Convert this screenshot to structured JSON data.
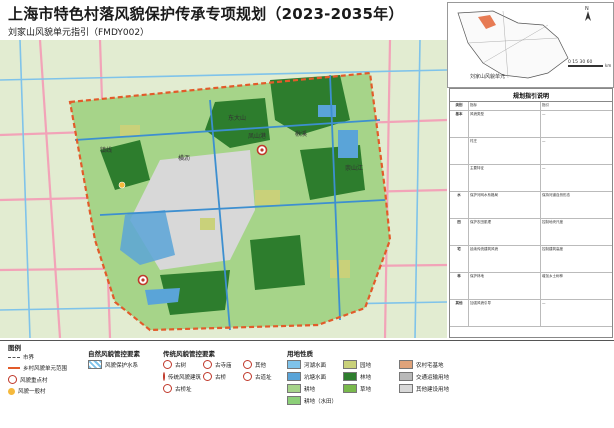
{
  "header": {
    "title": "上海市特色村落风貌保护传承专项规划（2023-2035年）",
    "subtitle": "刘家山风貌单元指引（FMDY002）"
  },
  "map": {
    "place_labels": [
      "东大山",
      "凤山港",
      "楸溪",
      "横沥",
      "镇线",
      "崇山江"
    ],
    "village_markers": [
      "风貌重点村",
      "风貌一般村"
    ]
  },
  "inset": {
    "label": "刘家山风貌单元",
    "scale_text": "0  15  30     60",
    "scale_unit": "km"
  },
  "panel": {
    "title": "规划指引说明",
    "rows": [
      {
        "c1": "类别",
        "c2": "指标",
        "c3": "指引"
      },
      {
        "c1": "基本",
        "c2": "风貌类型",
        "c3": "—"
      },
      {
        "c1": "",
        "c2": "村庄",
        "c3": "—"
      },
      {
        "c1": "",
        "c2": "主要特征",
        "c3": "—"
      },
      {
        "c1": "水",
        "c2": "保护河网水系格局",
        "c3": "保持河道自然形态"
      },
      {
        "c1": "田",
        "c2": "保护农田肌理",
        "c3": "控制地块尺度"
      },
      {
        "c1": "宅",
        "c2": "延续传统建筑风貌",
        "c3": "控制建筑高度"
      },
      {
        "c1": "林",
        "c2": "保护林地",
        "c3": "增加乡土树种"
      },
      {
        "c1": "其他",
        "c2": "加强风貌引导",
        "c3": "—"
      }
    ]
  },
  "legend": {
    "section_title": "图例",
    "boundary_items": [
      "市界",
      "乡村风貌单元范围"
    ],
    "village_items": [
      "风貌重点村",
      "风貌一般村"
    ],
    "nature_title": "自然风貌管控要素",
    "nature_items": [
      "风貌保护水系"
    ],
    "heritage_title": "传统风貌管控要素",
    "heritage_items": [
      "古树",
      "古寺庙",
      "其他",
      "传统风貌建筑",
      "古桥",
      "古道址",
      "古桥址"
    ],
    "landuse_title": "用地性质",
    "landuse_items": [
      {
        "label": "河湖水面",
        "color": "#7fc3ea"
      },
      {
        "label": "园地",
        "color": "#c9d17a"
      },
      {
        "label": "农村宅基地",
        "color": "#e0a37a"
      },
      {
        "label": "坑塘水面",
        "color": "#5aa4d8"
      },
      {
        "label": "林地",
        "color": "#2d7d2d"
      },
      {
        "label": "交通运输用地",
        "color": "#b9b9b9"
      },
      {
        "label": "耕地",
        "color": "#a6d489"
      },
      {
        "label": "草地",
        "color": "#79b94c"
      },
      {
        "label": "其他建设用地",
        "color": "#d8d8d8"
      },
      {
        "label": "耕地（水田）",
        "color": "#8ccf78"
      }
    ]
  },
  "colors": {
    "boundary": "#e25b2a",
    "water": "#7fc3ea",
    "forest": "#2d7d2d",
    "farmland": "#a6d489",
    "road": "#f2a3b8"
  }
}
